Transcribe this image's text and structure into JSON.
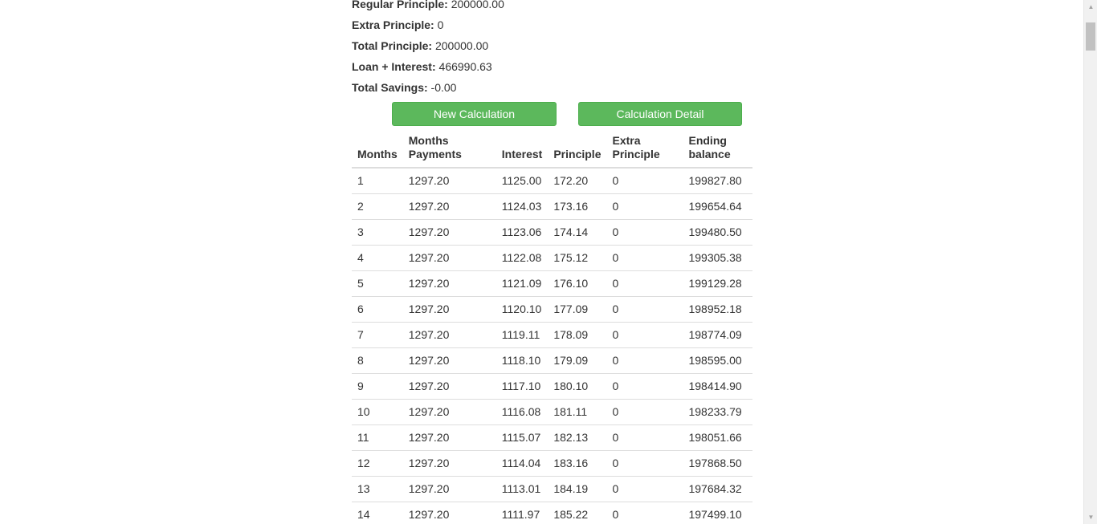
{
  "summary": {
    "regular_principle": {
      "label": "Regular Principle:",
      "value": "200000.00"
    },
    "extra_principle": {
      "label": "Extra Principle:",
      "value": "0"
    },
    "total_principle": {
      "label": "Total Principle:",
      "value": "200000.00"
    },
    "loan_interest": {
      "label": "Loan + Interest:",
      "value": "466990.63"
    },
    "total_savings": {
      "label": "Total Savings:",
      "value": "-0.00"
    }
  },
  "buttons": {
    "new_calculation": "New Calculation",
    "calculation_detail": "Calculation Detail",
    "color": "#5cb85c"
  },
  "table": {
    "headers": {
      "months": "Months",
      "months_payments": "Months Payments",
      "interest": "Interest",
      "principle": "Principle",
      "extra_principle": "Extra Principle",
      "ending_balance": "Ending balance"
    },
    "rows": [
      {
        "month": "1",
        "payment": "1297.20",
        "interest": "1125.00",
        "principle": "172.20",
        "extra": "0",
        "balance": "199827.80"
      },
      {
        "month": "2",
        "payment": "1297.20",
        "interest": "1124.03",
        "principle": "173.16",
        "extra": "0",
        "balance": "199654.64"
      },
      {
        "month": "3",
        "payment": "1297.20",
        "interest": "1123.06",
        "principle": "174.14",
        "extra": "0",
        "balance": "199480.50"
      },
      {
        "month": "4",
        "payment": "1297.20",
        "interest": "1122.08",
        "principle": "175.12",
        "extra": "0",
        "balance": "199305.38"
      },
      {
        "month": "5",
        "payment": "1297.20",
        "interest": "1121.09",
        "principle": "176.10",
        "extra": "0",
        "balance": "199129.28"
      },
      {
        "month": "6",
        "payment": "1297.20",
        "interest": "1120.10",
        "principle": "177.09",
        "extra": "0",
        "balance": "198952.18"
      },
      {
        "month": "7",
        "payment": "1297.20",
        "interest": "1119.11",
        "principle": "178.09",
        "extra": "0",
        "balance": "198774.09"
      },
      {
        "month": "8",
        "payment": "1297.20",
        "interest": "1118.10",
        "principle": "179.09",
        "extra": "0",
        "balance": "198595.00"
      },
      {
        "month": "9",
        "payment": "1297.20",
        "interest": "1117.10",
        "principle": "180.10",
        "extra": "0",
        "balance": "198414.90"
      },
      {
        "month": "10",
        "payment": "1297.20",
        "interest": "1116.08",
        "principle": "181.11",
        "extra": "0",
        "balance": "198233.79"
      },
      {
        "month": "11",
        "payment": "1297.20",
        "interest": "1115.07",
        "principle": "182.13",
        "extra": "0",
        "balance": "198051.66"
      },
      {
        "month": "12",
        "payment": "1297.20",
        "interest": "1114.04",
        "principle": "183.16",
        "extra": "0",
        "balance": "197868.50"
      },
      {
        "month": "13",
        "payment": "1297.20",
        "interest": "1113.01",
        "principle": "184.19",
        "extra": "0",
        "balance": "197684.32"
      },
      {
        "month": "14",
        "payment": "1297.20",
        "interest": "1111.97",
        "principle": "185.22",
        "extra": "0",
        "balance": "197499.10"
      }
    ]
  },
  "scrollbar": {
    "up_icon": "triangle-up",
    "down_icon": "triangle-down"
  }
}
